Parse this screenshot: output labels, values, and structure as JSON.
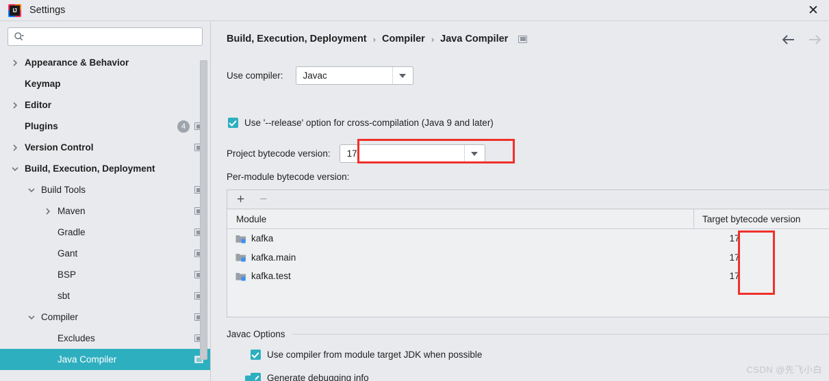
{
  "window": {
    "title": "Settings",
    "app_icon": "intellij-idea-icon",
    "close_label": "✕"
  },
  "sidebar": {
    "search": {
      "placeholder": "",
      "value": "",
      "icon": "search-icon"
    },
    "items": [
      {
        "label": "Appearance & Behavior",
        "indent": 0,
        "arrow": "right",
        "bold": true,
        "badge": null,
        "monitor": false
      },
      {
        "label": "Keymap",
        "indent": 0,
        "arrow": "none",
        "bold": true,
        "badge": null,
        "monitor": false
      },
      {
        "label": "Editor",
        "indent": 0,
        "arrow": "right",
        "bold": true,
        "badge": null,
        "monitor": false
      },
      {
        "label": "Plugins",
        "indent": 0,
        "arrow": "none",
        "bold": true,
        "badge": "4",
        "monitor": true
      },
      {
        "label": "Version Control",
        "indent": 0,
        "arrow": "right",
        "bold": true,
        "badge": null,
        "monitor": true
      },
      {
        "label": "Build, Execution, Deployment",
        "indent": 0,
        "arrow": "down",
        "bold": true,
        "badge": null,
        "monitor": false
      },
      {
        "label": "Build Tools",
        "indent": 1,
        "arrow": "down",
        "bold": false,
        "badge": null,
        "monitor": true
      },
      {
        "label": "Maven",
        "indent": 2,
        "arrow": "right",
        "bold": false,
        "badge": null,
        "monitor": true
      },
      {
        "label": "Gradle",
        "indent": 2,
        "arrow": "none",
        "bold": false,
        "badge": null,
        "monitor": true
      },
      {
        "label": "Gant",
        "indent": 2,
        "arrow": "none",
        "bold": false,
        "badge": null,
        "monitor": true
      },
      {
        "label": "BSP",
        "indent": 2,
        "arrow": "none",
        "bold": false,
        "badge": null,
        "monitor": true
      },
      {
        "label": "sbt",
        "indent": 2,
        "arrow": "none",
        "bold": false,
        "badge": null,
        "monitor": true
      },
      {
        "label": "Compiler",
        "indent": 1,
        "arrow": "down",
        "bold": false,
        "badge": null,
        "monitor": true
      },
      {
        "label": "Excludes",
        "indent": 2,
        "arrow": "none",
        "bold": false,
        "badge": null,
        "monitor": true
      },
      {
        "label": "Java Compiler",
        "indent": 2,
        "arrow": "none",
        "bold": false,
        "badge": null,
        "monitor": true,
        "selected": true
      }
    ],
    "selected_color": "#2eafbf"
  },
  "breadcrumb": {
    "part1": "Build, Execution, Deployment",
    "sep1": "›",
    "part2": "Compiler",
    "sep2": "›",
    "part3": "Java Compiler"
  },
  "nav": {
    "back_icon": "arrow-left-icon",
    "forward_icon": "arrow-right-icon"
  },
  "form": {
    "use_compiler_label": "Use compiler:",
    "use_compiler_value": "Javac",
    "release_option_label": "Use '--release' option for cross-compilation (Java 9 and later)",
    "release_option_checked": true,
    "project_bytecode_label": "Project bytecode version:",
    "project_bytecode_value": "17",
    "per_module_label": "Per-module bytecode version:"
  },
  "table": {
    "add_label": "+",
    "remove_label": "−",
    "columns": [
      "Module",
      "Target bytecode version"
    ],
    "rows": [
      {
        "module": "kafka",
        "target": "17"
      },
      {
        "module": "kafka.main",
        "target": "17"
      },
      {
        "module": "kafka.test",
        "target": "17"
      }
    ]
  },
  "javac": {
    "section_title": "Javac Options",
    "options": [
      {
        "label": "Use compiler from module target JDK when possible",
        "checked": true
      },
      {
        "label": "Generate debugging info",
        "checked": true
      }
    ]
  },
  "annotations": {
    "highlight_color": "#f0302a",
    "boxes": [
      "project-bytecode-field",
      "target-bytecode-values"
    ]
  },
  "watermark": "CSDN @先飞小白"
}
